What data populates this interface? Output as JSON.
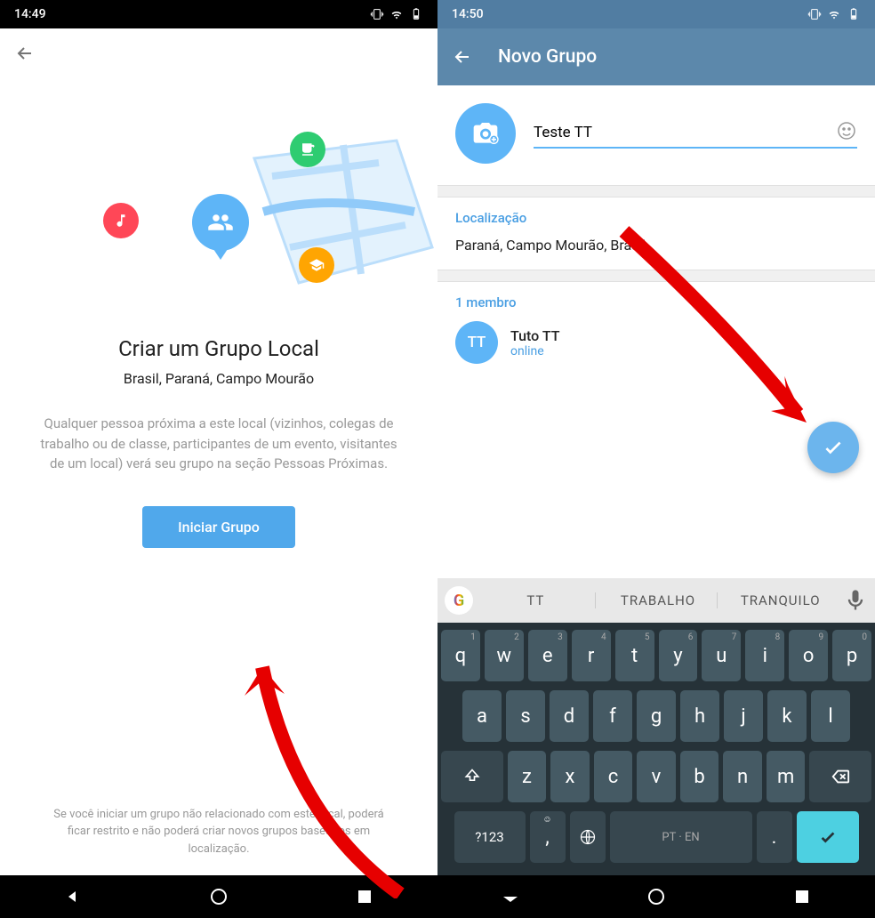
{
  "left": {
    "status_time": "14:49",
    "heading": "Criar um Grupo Local",
    "subheading": "Brasil, Paraná, Campo Mourão",
    "description": "Qualquer pessoa próxima a este local (vizinhos, colegas de trabalho ou de classe, participantes de um evento, visitantes de um local) verá seu grupo na seção Pessoas Próximas.",
    "button": "Iniciar Grupo",
    "footer": "Se você iniciar um grupo não relacionado com este local, poderá ficar restrito e não poderá criar novos grupos baseados em localização."
  },
  "right": {
    "status_time": "14:50",
    "appbar_title": "Novo Grupo",
    "group_name_value": "Teste TT",
    "location_label": "Localização",
    "location_value": "Paraná, Campo Mourão, Brasil",
    "members_label": "1 membro",
    "member": {
      "initials": "TT",
      "name": "Tuto TT",
      "status": "online"
    },
    "suggestions": [
      "TT",
      "TRABALHO",
      "TRANQUILO"
    ],
    "keyboard": {
      "row1": [
        {
          "k": "q",
          "n": "1"
        },
        {
          "k": "w",
          "n": "2"
        },
        {
          "k": "e",
          "n": "3"
        },
        {
          "k": "r",
          "n": "4"
        },
        {
          "k": "t",
          "n": "5"
        },
        {
          "k": "y",
          "n": "6"
        },
        {
          "k": "u",
          "n": "7"
        },
        {
          "k": "i",
          "n": "8"
        },
        {
          "k": "o",
          "n": "9"
        },
        {
          "k": "p",
          "n": "0"
        }
      ],
      "row2": [
        "a",
        "s",
        "d",
        "f",
        "g",
        "h",
        "j",
        "k",
        "l"
      ],
      "row3": [
        "z",
        "x",
        "c",
        "v",
        "b",
        "n",
        "m"
      ],
      "numkey": "?123",
      "space": "PT · EN"
    }
  }
}
